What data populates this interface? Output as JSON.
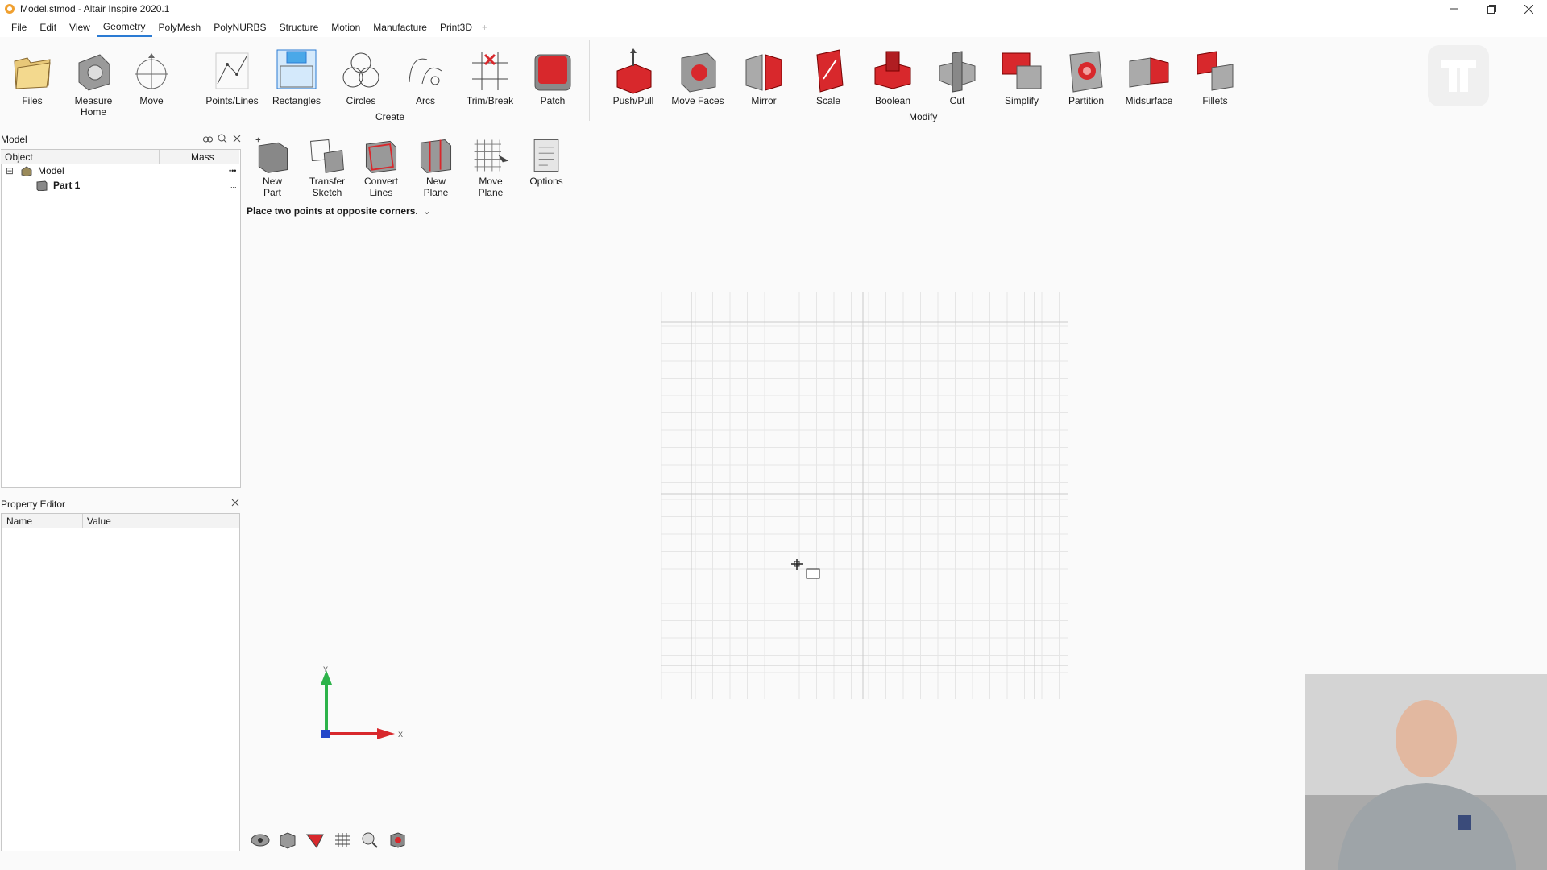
{
  "window": {
    "title": "Model.stmod - Altair Inspire 2020.1"
  },
  "menu": {
    "items": [
      "File",
      "Edit",
      "View",
      "Geometry",
      "PolyMesh",
      "PolyNURBS",
      "Structure",
      "Motion",
      "Manufacture",
      "Print3D"
    ],
    "active": "Geometry",
    "plus": "+"
  },
  "ribbon": {
    "tools": {
      "files": "Files",
      "measure": "Measure",
      "home": "Home",
      "move": "Move",
      "points_lines": "Points/Lines",
      "rectangles": "Rectangles",
      "circles": "Circles",
      "arcs": "Arcs",
      "trim_break": "Trim/Break",
      "patch": "Patch",
      "push_pull": "Push/Pull",
      "move_faces": "Move Faces",
      "mirror": "Mirror",
      "scale": "Scale",
      "boolean": "Boolean",
      "cut": "Cut",
      "simplify": "Simplify",
      "partition": "Partition",
      "midsurface": "Midsurface",
      "fillets": "Fillets"
    },
    "groups": {
      "create": "Create",
      "modify": "Modify"
    }
  },
  "sub_ribbon": {
    "new_part": [
      "New",
      "Part"
    ],
    "transfer_sketch": [
      "Transfer",
      "Sketch"
    ],
    "convert_lines": [
      "Convert",
      "Lines"
    ],
    "new_plane": [
      "New",
      "Plane"
    ],
    "move_plane": [
      "Move",
      "Plane"
    ],
    "options": "Options"
  },
  "prompt": {
    "text": "Place two points at opposite corners.",
    "chevron": "⌄"
  },
  "model_browser": {
    "title": "Model",
    "columns": [
      "Object",
      "Mass"
    ],
    "rows": [
      {
        "label": "Model",
        "expander": "⊟",
        "more": "•••"
      },
      {
        "label": "Part 1",
        "more": "..."
      }
    ]
  },
  "property_editor": {
    "title": "Property Editor",
    "columns": [
      "Name",
      "Value"
    ]
  },
  "triad": {
    "y_label": "Y",
    "x_label": "X"
  },
  "colors": {
    "accent": "#2b7bd3",
    "tool_red": "#d8282c",
    "axis_green": "#2db34a",
    "axis_red": "#d8282c"
  }
}
